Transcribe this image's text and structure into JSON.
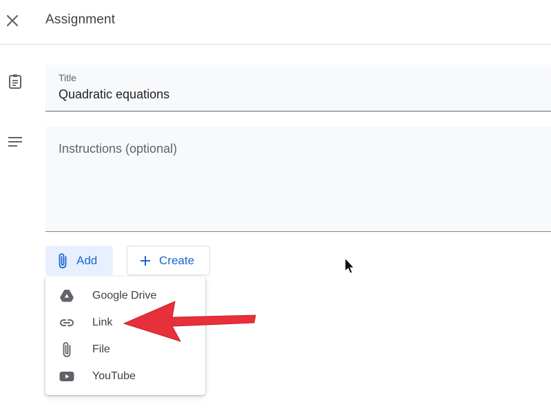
{
  "header": {
    "close_icon": "close-icon",
    "title": "Assignment"
  },
  "sidebar_icons": [
    "assignment-icon",
    "notes-icon"
  ],
  "form": {
    "title_field": {
      "label": "Title",
      "value": "Quadratic equations"
    },
    "instructions_field": {
      "placeholder": "Instructions (optional)",
      "value": ""
    }
  },
  "actions": {
    "add_label": "Add",
    "add_icon": "paperclip-icon",
    "create_label": "Create",
    "create_icon": "plus-icon"
  },
  "add_menu": {
    "items": [
      {
        "label": "Google Drive",
        "icon": "google-drive-icon"
      },
      {
        "label": "Link",
        "icon": "link-icon"
      },
      {
        "label": "File",
        "icon": "paperclip-icon"
      },
      {
        "label": "YouTube",
        "icon": "youtube-icon"
      }
    ]
  },
  "colors": {
    "accent": "#1967d2",
    "accent_bg": "#e8f0fe",
    "annotation_arrow": "#e8303a"
  },
  "annotation": {
    "type": "arrow",
    "points_to": "Link"
  }
}
